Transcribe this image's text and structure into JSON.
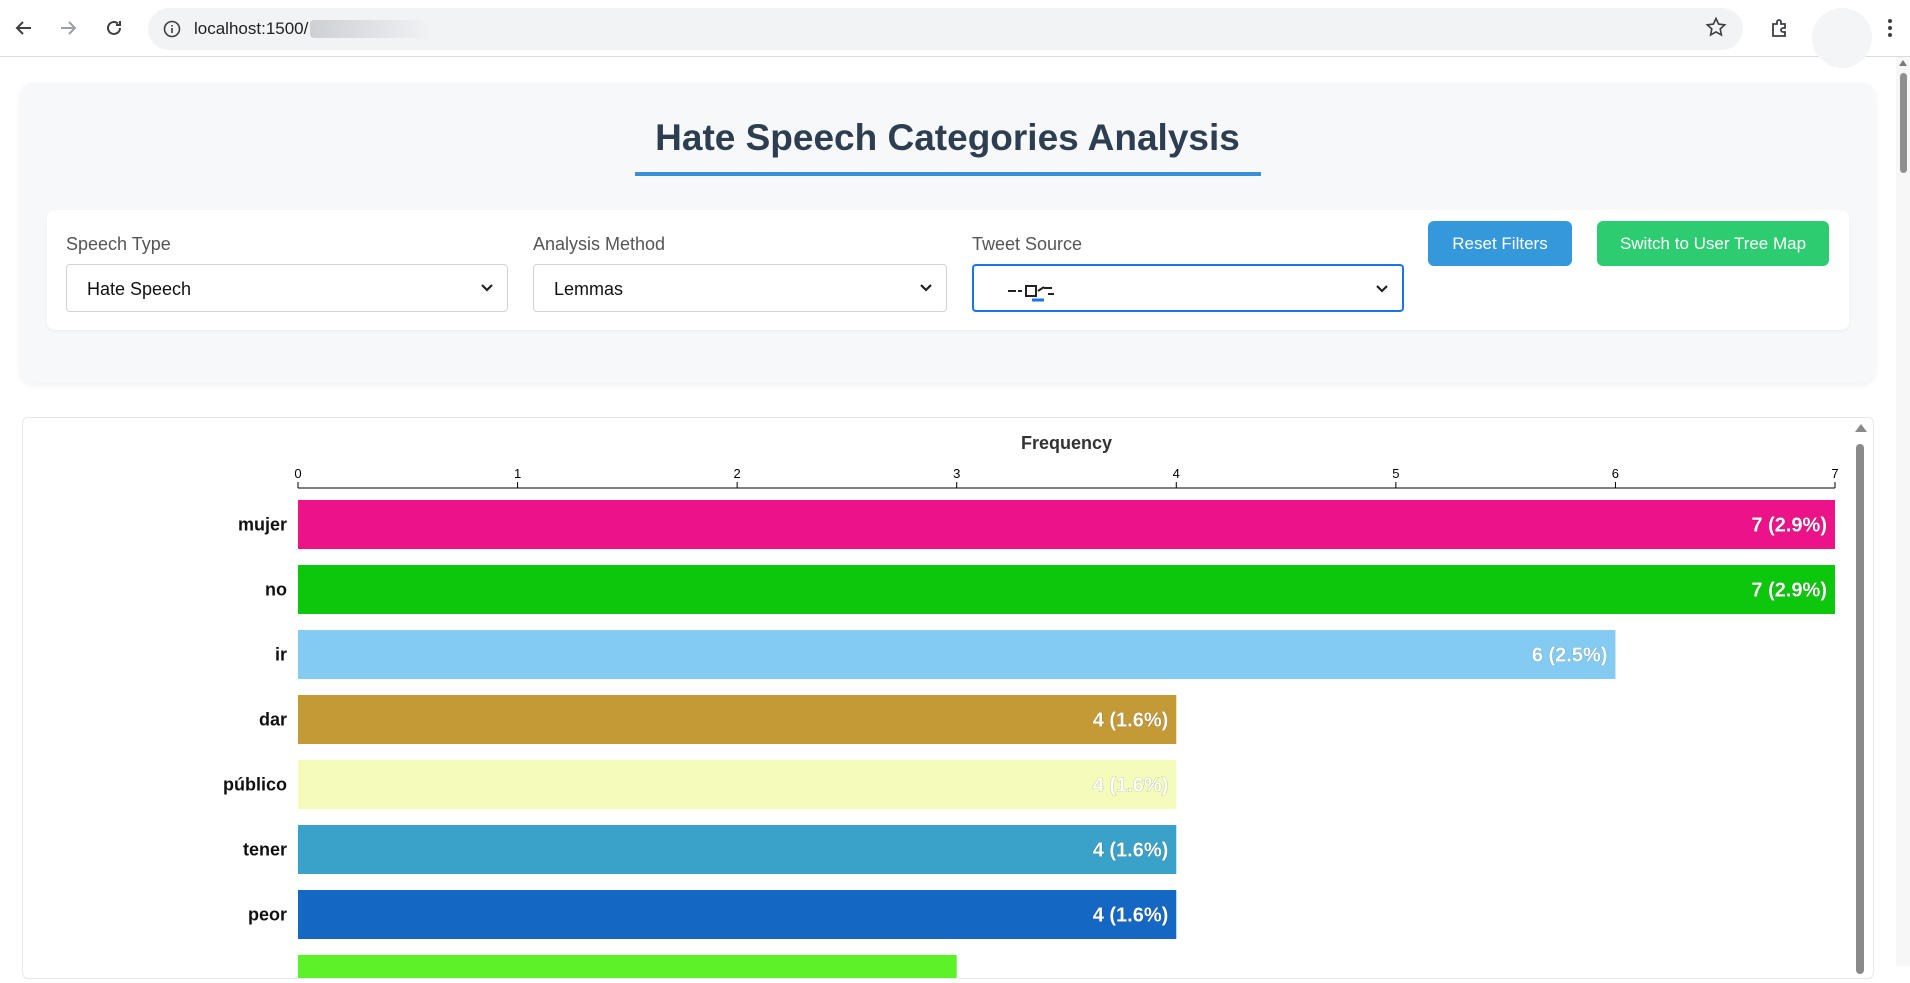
{
  "browser": {
    "url": "localhost:1500/",
    "icons": {
      "back": "arrow-left-icon",
      "forward": "arrow-right-icon",
      "reload": "reload-icon",
      "site_info": "info-icon",
      "bookmark": "star-icon",
      "extensions": "puzzle-icon",
      "menu": "more-vertical-icon"
    }
  },
  "page": {
    "title": "Hate Speech Categories Analysis",
    "accent_color": "#3a8fd8"
  },
  "filters": {
    "speech_type": {
      "label": "Speech Type",
      "value": "Hate Speech"
    },
    "analysis_method": {
      "label": "Analysis Method",
      "value": "Lemmas"
    },
    "tweet_source": {
      "label": "Tweet Source",
      "value": ""
    },
    "reset_button": {
      "label": "Reset Filters",
      "color": "#3498db"
    },
    "switch_button": {
      "label": "Switch to User Tree Map",
      "color": "#2ecc71"
    }
  },
  "chart_data": {
    "type": "bar",
    "orientation": "horizontal",
    "xlabel": "Frequency",
    "x_axis_position": "top",
    "xlim": [
      0,
      7
    ],
    "ticks": [
      "0",
      "1",
      "2",
      "3",
      "4",
      "5",
      "6",
      "7"
    ],
    "categories": [
      "mujer",
      "no",
      "ir",
      "dar",
      "público",
      "tener",
      "peor",
      ""
    ],
    "values": [
      7,
      7,
      6,
      4,
      4,
      4,
      4,
      3
    ],
    "labels": [
      "7 (2.9%)",
      "7 (2.9%)",
      "6 (2.5%)",
      "4 (1.6%)",
      "4 (1.6%)",
      "4 (1.6%)",
      "4 (1.6%)",
      ""
    ],
    "colors": [
      "#ec1388",
      "#0cc70c",
      "#83cbf0",
      "#c49a36",
      "#f5fbb9",
      "#3aa1c9",
      "#1567c4",
      "#5bf22a"
    ]
  }
}
